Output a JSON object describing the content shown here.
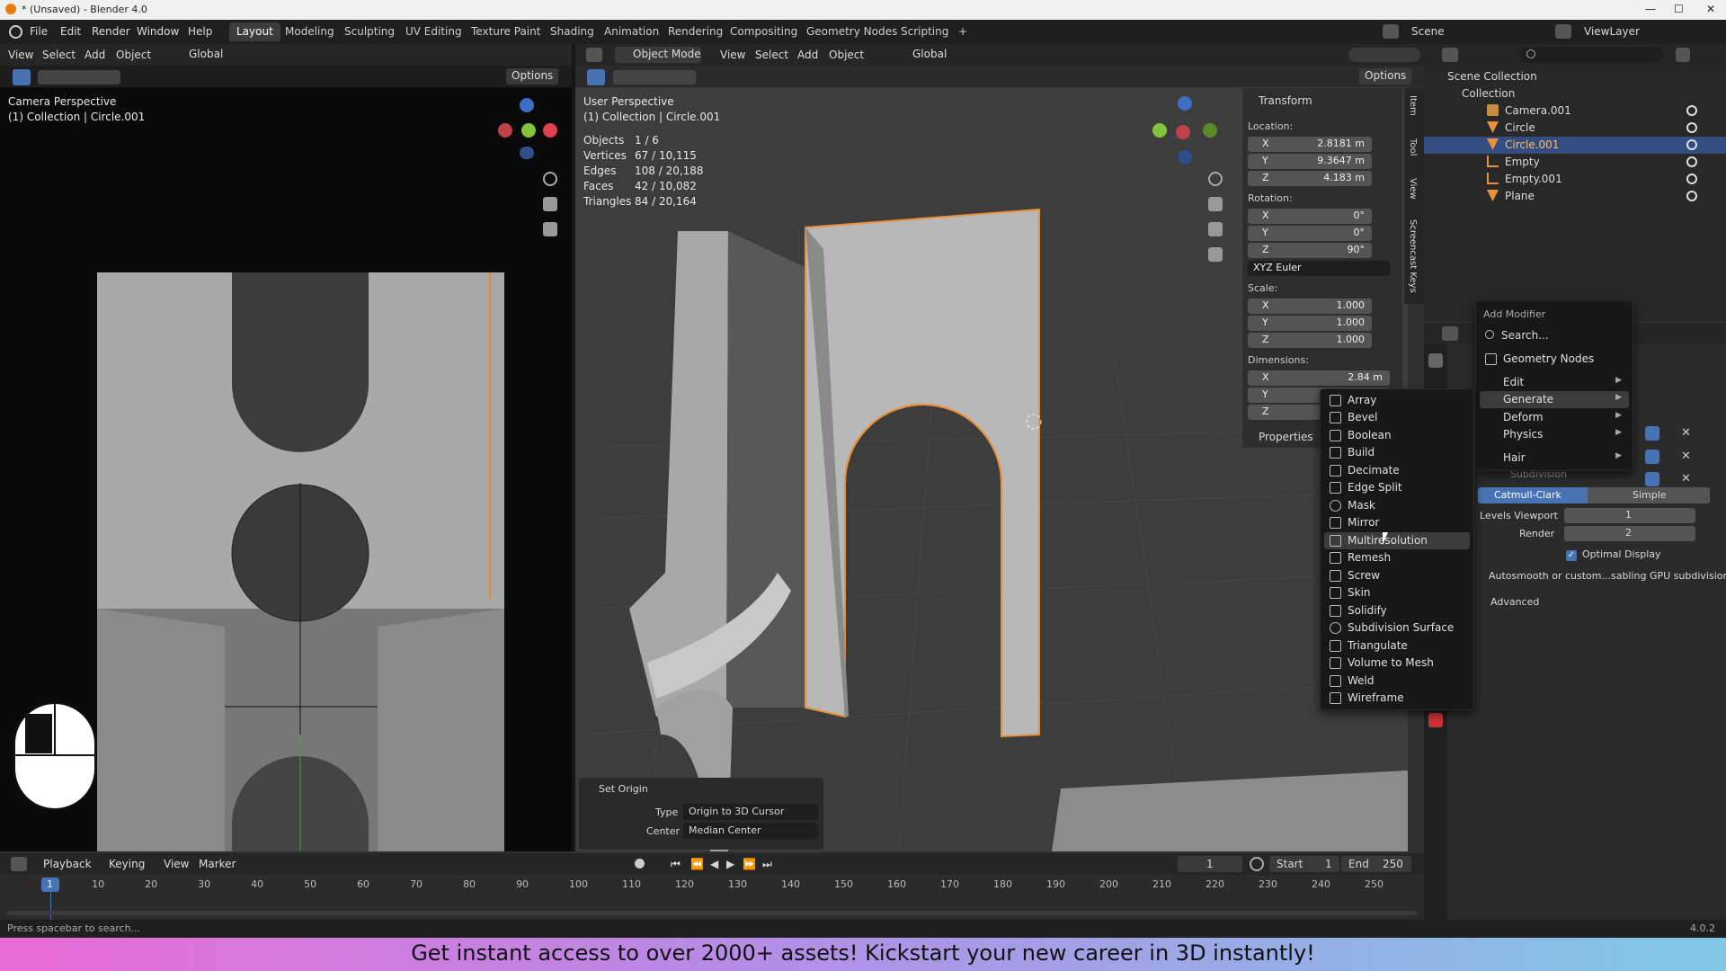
{
  "titlebar": {
    "title": "* (Unsaved) - Blender 4.0",
    "min": "—",
    "max": "☐",
    "close": "✕"
  },
  "menubar": {
    "items": [
      "File",
      "Edit",
      "Render",
      "Window",
      "Help"
    ],
    "tabs": [
      "Layout",
      "Modeling",
      "Sculpting",
      "UV Editing",
      "Texture Paint",
      "Shading",
      "Animation",
      "Rendering",
      "Compositing",
      "Geometry Nodes",
      "Scripting"
    ],
    "add_tab": "+",
    "scene": "Scene",
    "view_layer": "ViewLayer"
  },
  "left_header": {
    "items": [
      "View",
      "Select",
      "Add",
      "Object"
    ],
    "transform": "Global",
    "options": "Options"
  },
  "left_view": {
    "title": "Camera Perspective",
    "subtitle": "(1) Collection | Circle.001"
  },
  "main_header": {
    "mode": "Object Mode",
    "items": [
      "View",
      "Select",
      "Add",
      "Object"
    ],
    "transform": "Global",
    "options": "Options"
  },
  "main_view": {
    "title": "User Perspective",
    "subtitle": "(1) Collection | Circle.001",
    "stats": [
      {
        "k": "Objects",
        "v": "1 / 6"
      },
      {
        "k": "Vertices",
        "v": "67 / 10,115"
      },
      {
        "k": "Edges",
        "v": "108 / 20,188"
      },
      {
        "k": "Faces",
        "v": "42 / 10,082"
      },
      {
        "k": "Triangles",
        "v": "84 / 20,164"
      }
    ]
  },
  "gizmo": {
    "x": "X",
    "y": "Y",
    "z": "Z"
  },
  "transform": {
    "title": "Transform",
    "location_label": "Location:",
    "loc": [
      {
        "a": "X",
        "v": "2.8181 m"
      },
      {
        "a": "Y",
        "v": "9.3647 m"
      },
      {
        "a": "Z",
        "v": "4.183 m"
      }
    ],
    "rotation_label": "Rotation:",
    "rot": [
      {
        "a": "X",
        "v": "0°"
      },
      {
        "a": "Y",
        "v": "0°"
      },
      {
        "a": "Z",
        "v": "90°"
      }
    ],
    "euler": "XYZ Euler",
    "scale_label": "Scale:",
    "scale": [
      {
        "a": "X",
        "v": "1.000"
      },
      {
        "a": "Y",
        "v": "1.000"
      },
      {
        "a": "Z",
        "v": "1.000"
      }
    ],
    "dimensions_label": "Dimensions:",
    "dim": [
      {
        "a": "X",
        "v": "2.84 m"
      },
      {
        "a": "Y",
        "v": ""
      },
      {
        "a": "Z",
        "v": ""
      }
    ],
    "properties": "Properties"
  },
  "side_tabs": [
    "Item",
    "Tool",
    "View",
    "Screencast Keys"
  ],
  "generate_menu": {
    "items": [
      "Array",
      "Bevel",
      "Boolean",
      "Build",
      "Decimate",
      "Edge Split",
      "Mask",
      "Mirror",
      "Multiresolution",
      "Remesh",
      "Screw",
      "Skin",
      "Solidify",
      "Subdivision Surface",
      "Triangulate",
      "Volume to Mesh",
      "Weld",
      "Wireframe"
    ],
    "highlight": "Multiresolution"
  },
  "add_modifier": {
    "title": "Add Modifier",
    "search": "Search...",
    "items": [
      "Geometry Nodes",
      "Edit",
      "Generate",
      "Deform",
      "Physics",
      "Hair"
    ],
    "highlight": "Generate"
  },
  "set_origin": {
    "title": "Set Origin",
    "type_label": "Type",
    "type_value": "Origin to 3D Cursor",
    "center_label": "Center",
    "center_value": "Median Center"
  },
  "outliner": {
    "search": "",
    "root": "Scene Collection",
    "collection": "Collection",
    "rows": [
      "Camera.001",
      "Circle",
      "Circle.001",
      "Empty",
      "Empty.001",
      "Plane"
    ],
    "selected": "Circle.001"
  },
  "props": {
    "subdiv_tabs": [
      "Catmull-Clark",
      "Simple"
    ],
    "levels_label": "Levels Viewport",
    "levels_value": "1",
    "render_label": "Render",
    "render_value": "2",
    "optimal": "Optimal Display",
    "autosmooth": "Autosmooth or custom...sabling GPU subdivision",
    "advanced": "Advanced",
    "subdivision": "Subdivision"
  },
  "timeline": {
    "items": [
      "Playback",
      "Keying",
      "View",
      "Marker"
    ],
    "current": "1",
    "start_label": "Start",
    "start": "1",
    "end_label": "End",
    "end": "250",
    "ticks": [
      "1",
      "10",
      "20",
      "30",
      "40",
      "50",
      "60",
      "70",
      "80",
      "90",
      "100",
      "110",
      "120",
      "130",
      "140",
      "150",
      "160",
      "170",
      "180",
      "190",
      "200",
      "210",
      "220",
      "230",
      "240",
      "250"
    ]
  },
  "status": {
    "left": "Press spacebar to search...",
    "version": "4.0.2"
  },
  "banner": "Get instant access to over 2000+ assets! Kickstart your new career in 3D instantly!"
}
